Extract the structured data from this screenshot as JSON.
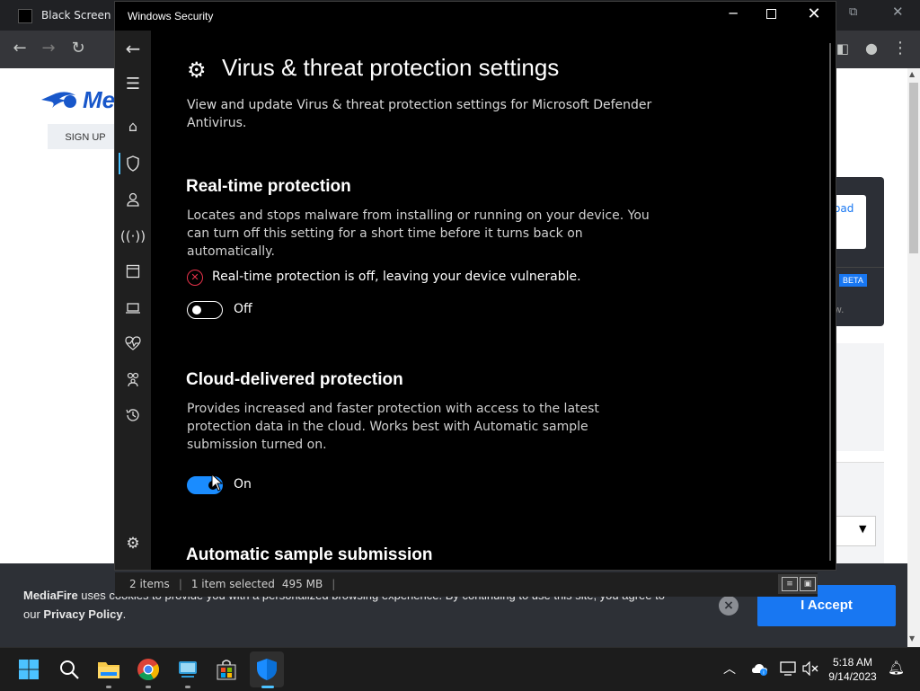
{
  "browser": {
    "tab_title": "Black Screen",
    "signup_label": "SIGN UP",
    "logo_text": "Me",
    "download_fragment": "oad",
    "beta_badge": "BETA",
    "faint_text": "w.",
    "cookie": {
      "brand": "MediaFire",
      "text": " uses cookies to provide you with a personalized browsing experience. By continuing to use this site, you agree to our ",
      "policy": "Privacy Policy",
      "suffix": ".",
      "accept_label": "I Accept",
      "close_icon": "×"
    }
  },
  "explorer_status": {
    "items": "2 items",
    "selected": "1 item selected",
    "size": "495 MB"
  },
  "window": {
    "title": "Windows Security",
    "minimize": "─",
    "close": "✕"
  },
  "nav": {
    "icons": [
      "back-arrow-icon",
      "hamburger-menu-icon",
      "home-icon",
      "shield-icon",
      "account-person-icon",
      "wireless-antenna-icon",
      "app-browser-icon",
      "laptop-device-icon",
      "heart-pulse-icon",
      "family-icon",
      "history-icon",
      "gear-icon"
    ]
  },
  "page": {
    "heading": "Virus & threat protection settings",
    "description": "View and update Virus & threat protection settings for Microsoft Defender Antivirus."
  },
  "sections": {
    "realtime": {
      "title": "Real-time protection",
      "description": "Locates and stops malware from installing or running on your device. You can turn off this setting for a short time before it turns back on automatically.",
      "warning": "Real-time protection is off, leaving your device vulnerable.",
      "toggle_label": "Off",
      "toggle_on": false
    },
    "cloud": {
      "title": "Cloud-delivered protection",
      "description": "Provides increased and faster protection with access to the latest protection data in the cloud. Works best with Automatic sample submission turned on.",
      "toggle_label": "On",
      "toggle_on": true
    },
    "sample": {
      "title": "Automatic sample submission"
    }
  },
  "taskbar": {
    "time": "5:18 AM",
    "date": "9/14/2023"
  },
  "colors": {
    "accent": "#1a8cff",
    "warning": "#e8324a",
    "mediafire_blue": "#1877f2"
  }
}
